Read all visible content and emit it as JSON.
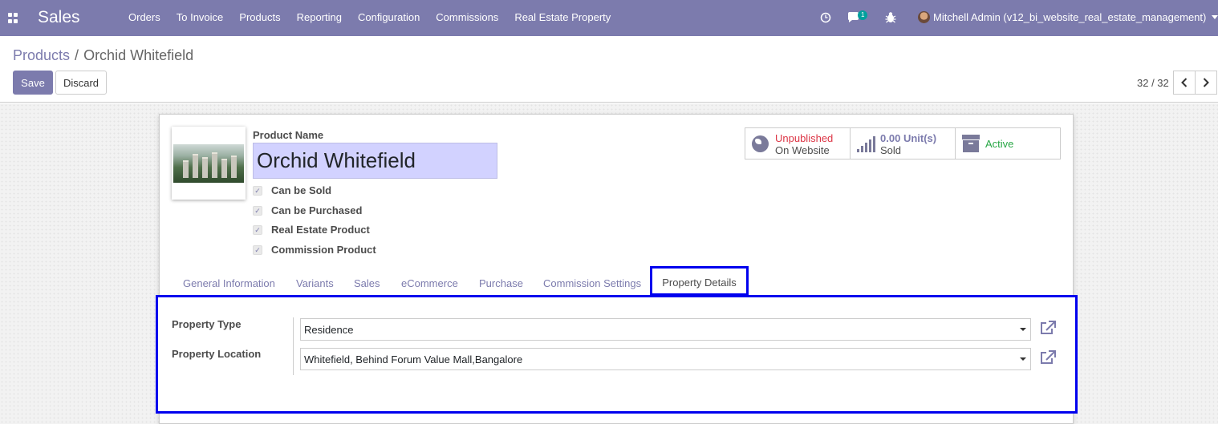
{
  "navbar": {
    "brand": "Sales",
    "menu": [
      "Orders",
      "To Invoice",
      "Products",
      "Reporting",
      "Configuration",
      "Commissions",
      "Real Estate Property"
    ],
    "messages_badge": "1",
    "user": "Mitchell Admin (v12_bi_website_real_estate_management)",
    "icons": [
      "apps-icon",
      "clock-icon",
      "chat-icon",
      "bug-icon",
      "avatar"
    ]
  },
  "control": {
    "breadcrumb_parent": "Products",
    "breadcrumb_separator": "/",
    "breadcrumb_current": "Orchid Whitefield",
    "save_label": "Save",
    "discard_label": "Discard",
    "pager": "32 / 32"
  },
  "form": {
    "product_name_label": "Product Name",
    "product_name": "Orchid Whitefield",
    "checkboxes": [
      {
        "label": "Can be Sold",
        "checked": true
      },
      {
        "label": "Can be Purchased",
        "checked": true
      },
      {
        "label": "Real Estate Product",
        "checked": true
      },
      {
        "label": "Commission Product",
        "checked": true
      }
    ],
    "stat_buttons": {
      "website_status": "Unpublished",
      "website_sub": "On Website",
      "sold_value": "0.00",
      "sold_unit": "Unit(s)",
      "sold_label": "Sold",
      "active_label": "Active"
    },
    "tabs": [
      "General Information",
      "Variants",
      "Sales",
      "eCommerce",
      "Purchase",
      "Commission Settings",
      "Property Details"
    ],
    "active_tab": "Property Details",
    "property": {
      "type_label": "Property Type",
      "type_value": "Residence",
      "location_label": "Property Location",
      "location_value": "Whitefield, Behind Forum Value Mall,Bangalore"
    }
  },
  "colors": {
    "navbar": "#7c7bad",
    "unpublished": "#dc3545",
    "active": "#28a745",
    "highlight_border": "#0000ee",
    "name_field_bg": "#d2d2ff"
  }
}
